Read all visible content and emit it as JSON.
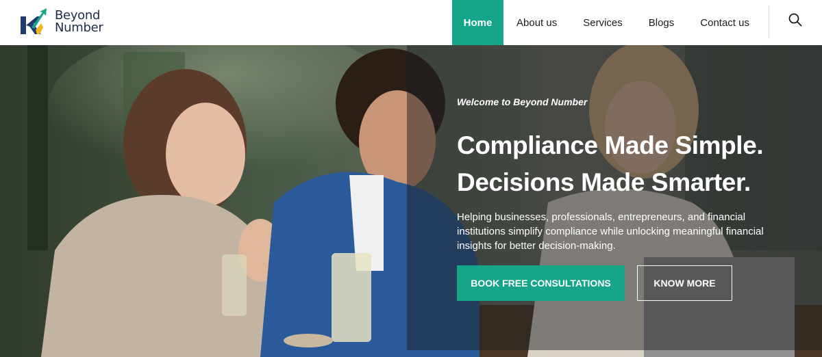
{
  "brand": {
    "line1": "Beyond",
    "line2": "Number",
    "colors": {
      "navy": "#1f3a6e",
      "green": "#17a58a",
      "gold": "#f2b51e"
    }
  },
  "nav": {
    "items": [
      {
        "label": "Home",
        "active": true
      },
      {
        "label": "About us",
        "active": false
      },
      {
        "label": "Services",
        "active": false
      },
      {
        "label": "Blogs",
        "active": false
      },
      {
        "label": "Contact us",
        "active": false
      }
    ],
    "search_icon": "search-icon"
  },
  "hero": {
    "eyebrow": "Welcome to Beyond Number",
    "headline_line1": "Compliance Made Simple.",
    "headline_line2": "Decisions Made Smarter.",
    "description": "Helping businesses, professionals, entrepreneurs, and financial institutions simplify compliance while unlocking meaningful financial insights for better decision-making.",
    "primary_button": "BOOK FREE CONSULTATIONS",
    "secondary_button": "KNOW MORE"
  },
  "theme": {
    "accent": "#17a58a",
    "text_dark": "#1b1b1b",
    "white": "#ffffff"
  }
}
